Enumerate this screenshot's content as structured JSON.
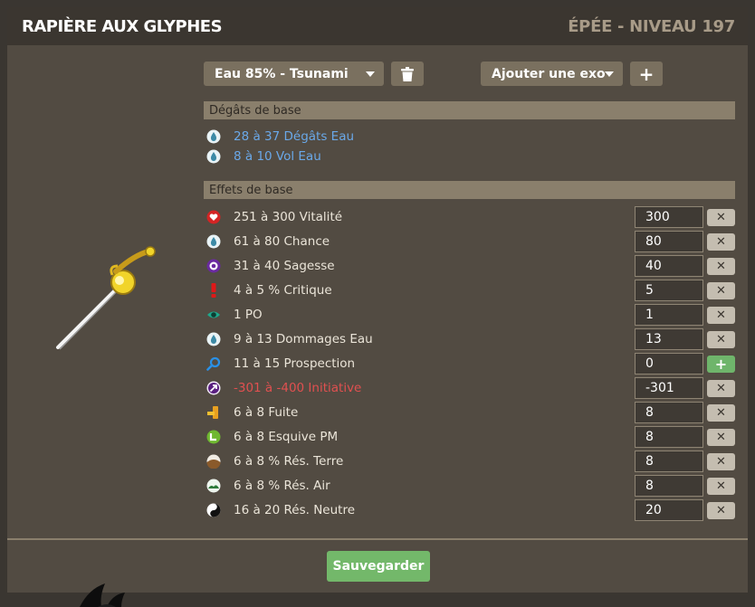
{
  "header": {
    "title": "RAPIÈRE AUX GLYPHES",
    "subtitle": "ÉPÉE - NIVEAU 197"
  },
  "controls": {
    "element_select": "Eau 85% - Tsunami",
    "exo_select": "Ajouter une exo"
  },
  "sections": {
    "base_damage": "Dégâts de base",
    "base_effects": "Effets de base"
  },
  "damage": [
    {
      "text": "28 à 37 Dégâts Eau",
      "icon": "water-icon"
    },
    {
      "text": "8 à 10 Vol Eau",
      "icon": "water-icon"
    }
  ],
  "effects": [
    {
      "text": "251 à 300 Vitalité",
      "value": "300",
      "icon": "vitality-icon",
      "action": "remove"
    },
    {
      "text": "61 à 80 Chance",
      "value": "80",
      "icon": "water-icon",
      "action": "remove"
    },
    {
      "text": "31 à 40 Sagesse",
      "value": "40",
      "icon": "wisdom-icon",
      "action": "remove"
    },
    {
      "text": "4 à 5 % Critique",
      "value": "5",
      "icon": "critical-icon",
      "action": "remove"
    },
    {
      "text": "1 PO",
      "value": "1",
      "icon": "range-icon",
      "action": "remove"
    },
    {
      "text": "9 à 13 Dommages Eau",
      "value": "13",
      "icon": "water-icon",
      "action": "remove"
    },
    {
      "text": "11 à 15 Prospection",
      "value": "0",
      "icon": "prospecting-icon",
      "action": "add"
    },
    {
      "text": "-301 à -400 Initiative",
      "value": "-301",
      "icon": "initiative-icon",
      "action": "remove",
      "negative": true
    },
    {
      "text": "6 à 8 Fuite",
      "value": "8",
      "icon": "dodge-icon",
      "action": "remove"
    },
    {
      "text": "6 à 8 Esquive PM",
      "value": "8",
      "icon": "mp-dodge-icon",
      "action": "remove"
    },
    {
      "text": "6 à 8 % Rés. Terre",
      "value": "8",
      "icon": "earth-resist-icon",
      "action": "remove"
    },
    {
      "text": "6 à 8 % Rés. Air",
      "value": "8",
      "icon": "air-resist-icon",
      "action": "remove"
    },
    {
      "text": "16 à 20 Rés. Neutre",
      "value": "20",
      "icon": "neutral-resist-icon",
      "action": "remove"
    }
  ],
  "save_label": "Sauvegarder",
  "colors": {
    "accent_green": "#73b86a",
    "damage_blue": "#6aa8e8",
    "negative_red": "#e05050"
  }
}
